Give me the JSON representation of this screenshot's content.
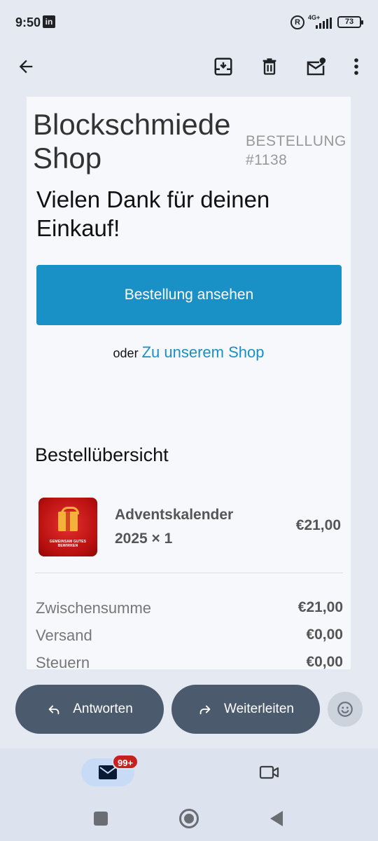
{
  "status_bar": {
    "time": "9:50",
    "notification_icon": "linkedin-icon",
    "network_label": "4G+",
    "battery_level": "73"
  },
  "app_bar": {
    "icons": [
      "back-arrow-icon",
      "archive-icon",
      "delete-icon",
      "mark-unread-icon",
      "more-vert-icon"
    ]
  },
  "email": {
    "shop_name": "Blockschmiede Shop",
    "order_label": "BESTELLUNG #1138",
    "thanks_heading": "Vielen Dank für deinen Einkauf!",
    "view_order_button": "Bestellung ansehen",
    "or_text": "oder",
    "shop_link": "Zu unserem Shop",
    "summary_heading": "Bestellübersicht",
    "items": [
      {
        "name": "Adventskalender 2025 × 1",
        "price": "€21,00",
        "image_caption": "GEMEINSAM GUTES BEWIRKEN"
      }
    ],
    "totals": [
      {
        "label": "Zwischensumme",
        "value": "€21,00"
      },
      {
        "label": "Versand",
        "value": "€0,00"
      },
      {
        "label": "Steuern",
        "value": "€0,00"
      }
    ]
  },
  "actions": {
    "reply_label": "Antworten",
    "forward_label": "Weiterleiten"
  },
  "bottom_nav": {
    "mail_badge": "99+"
  },
  "colors": {
    "accent": "#1990c6",
    "action_button": "#4c5a6d",
    "badge": "#c5221f",
    "background": "#e5e9f1"
  }
}
